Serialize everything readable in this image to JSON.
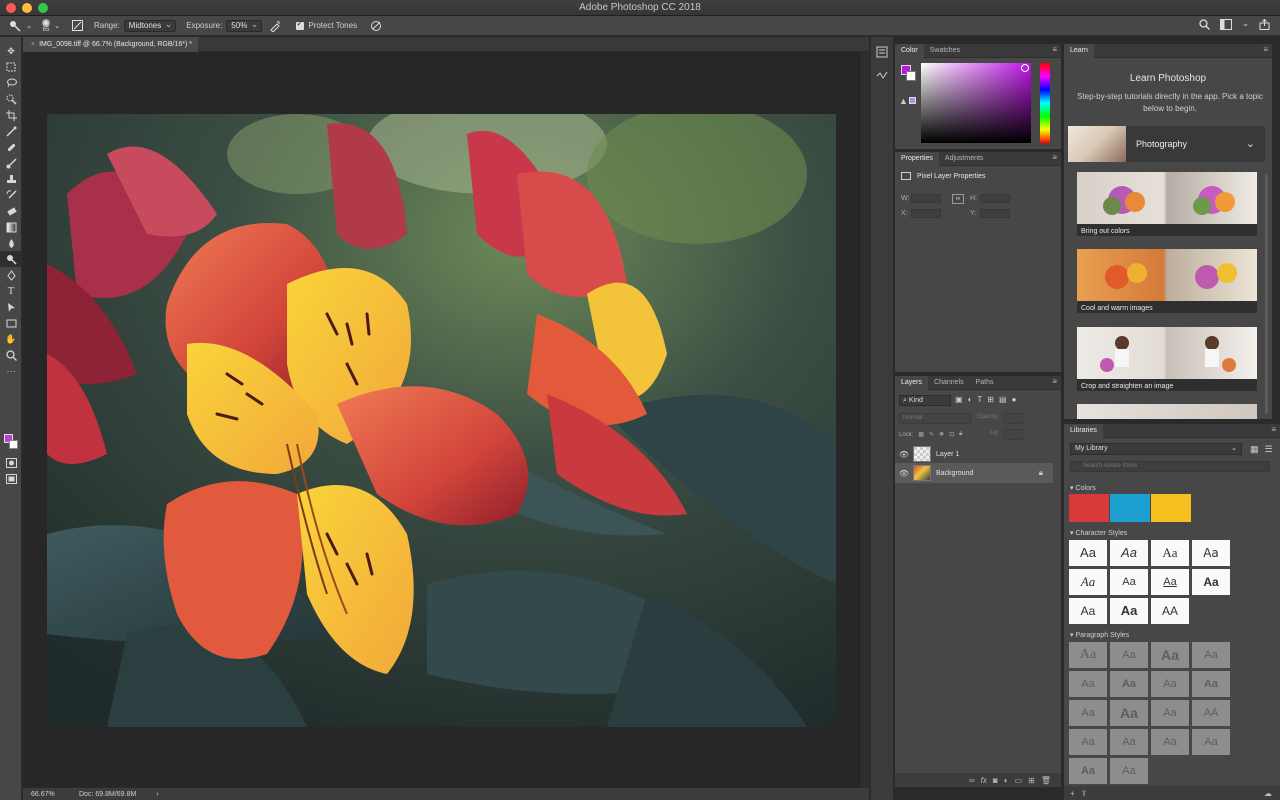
{
  "window": {
    "title": "Adobe Photoshop CC 2018",
    "traffic_lights": [
      "#fc5753",
      "#fdbc40",
      "#33c748"
    ]
  },
  "options_bar": {
    "tool_size": "65",
    "range_label": "Range:",
    "range_value": "Midtones",
    "exposure_label": "Exposure:",
    "exposure_value": "50%",
    "protect_tones_label": "Protect Tones",
    "protect_tones_checked": true
  },
  "toolbar": {
    "tools": [
      "move-tool",
      "marquee-tool",
      "lasso-tool",
      "quick-select-tool",
      "crop-tool",
      "eyedropper-tool",
      "healing-tool",
      "brush-tool",
      "stamp-tool",
      "history-brush-tool",
      "eraser-tool",
      "gradient-tool",
      "blur-tool",
      "dodge-tool",
      "pen-tool",
      "type-tool",
      "path-select-tool",
      "shape-tool",
      "hand-tool",
      "zoom-tool",
      "more-tools"
    ],
    "active_tool": "dodge-tool",
    "foreground_color": "#b83fd6",
    "background_color": "#ffffff"
  },
  "document": {
    "tab_title": "IMG_0098.tiff @ 66.7% (Background, RGB/16*) *",
    "zoom": "66.67%",
    "doc_size": "Doc: 69.8M/69.8M"
  },
  "color_panel": {
    "tabs": [
      "Color",
      "Swatches"
    ],
    "active_tab": "Color",
    "foreground": "#c015e8"
  },
  "properties_panel": {
    "tabs": [
      "Properties",
      "Adjustments"
    ],
    "active_tab": "Properties",
    "title": "Pixel Layer Properties",
    "w_label": "W:",
    "h_label": "H:",
    "x_label": "X:",
    "y_label": "Y:"
  },
  "layers_panel": {
    "tabs": [
      "Layers",
      "Channels",
      "Paths"
    ],
    "active_tab": "Layers",
    "filter": "Kind",
    "blend_mode": "Normal",
    "opacity_label": "Opacity:",
    "lock_label": "Lock:",
    "fill_label": "Fill:",
    "layers": [
      {
        "name": "Layer 1",
        "visible": true,
        "selected": false,
        "locked": false
      },
      {
        "name": "Background",
        "visible": true,
        "selected": true,
        "locked": true
      }
    ]
  },
  "learn_panel": {
    "tab": "Learn",
    "heading": "Learn Photoshop",
    "subtitle": "Step-by-step tutorials directly in the app. Pick a topic below to begin.",
    "topic": "Photography",
    "tutorials": [
      {
        "label": "Bring out colors"
      },
      {
        "label": "Cool and warm images"
      },
      {
        "label": "Crop and straighten an image"
      }
    ]
  },
  "libraries_panel": {
    "tab": "Libraries",
    "library": "My Library",
    "search_placeholder": "Search Adobe Stock",
    "colors_label": "Colors",
    "colors": [
      "#d63a3a",
      "#1a9fd0",
      "#f5c020"
    ],
    "character_styles_label": "Character Styles",
    "character_styles": [
      "Aa",
      "Aa",
      "Aa",
      "Aa",
      "Aa",
      "Aa",
      "Aa",
      "Aa",
      "Aa",
      "Aa",
      "AA"
    ],
    "paragraph_styles_label": "Paragraph Styles",
    "paragraph_styles": [
      "Aa",
      "Aa",
      "Aa",
      "Aa",
      "Aa",
      "Aa",
      "Aa",
      "Aa",
      "Aa",
      "Aa",
      "Aa",
      "AA",
      "Aa",
      "Aa",
      "Aa",
      "Aa",
      "Aa",
      "Aa"
    ]
  }
}
